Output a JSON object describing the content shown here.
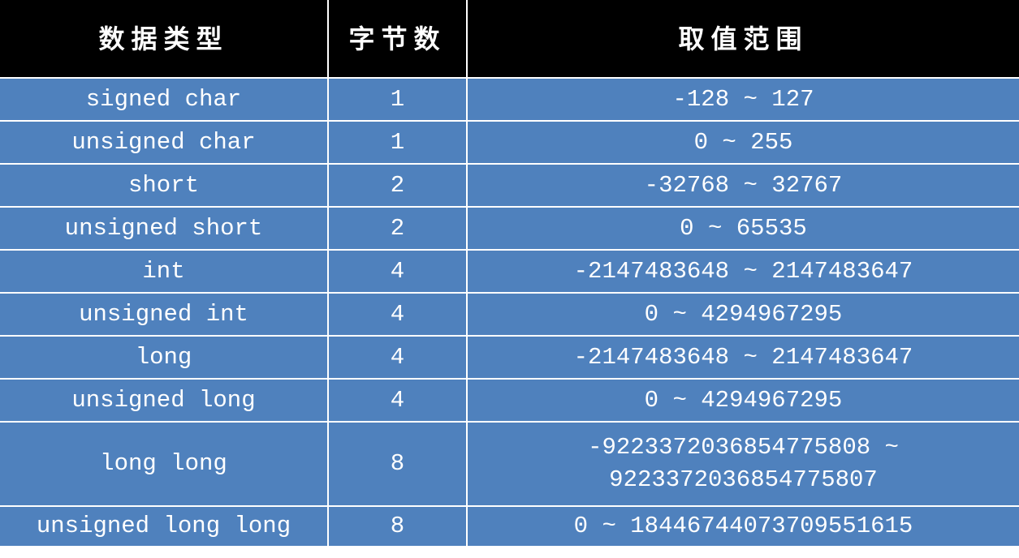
{
  "table": {
    "headers": [
      "数据类型",
      "字节数",
      "取值范围"
    ],
    "rows": [
      [
        "signed char",
        "1",
        "-128 ~ 127"
      ],
      [
        "unsigned char",
        "1",
        "0 ~ 255"
      ],
      [
        "short",
        "2",
        "-32768 ~ 32767"
      ],
      [
        "unsigned short",
        "2",
        "0 ~ 65535"
      ],
      [
        "int",
        "4",
        "-2147483648 ~ 2147483647"
      ],
      [
        "unsigned int",
        "4",
        "0 ~ 4294967295"
      ],
      [
        "long",
        "4",
        "-2147483648 ~ 2147483647"
      ],
      [
        "unsigned long",
        "4",
        "0 ~ 4294967295"
      ],
      [
        "long long",
        "8",
        "-9223372036854775808 ~ 9223372036854775807"
      ],
      [
        "unsigned long long",
        "8",
        "0 ~ 18446744073709551615"
      ]
    ]
  },
  "colors": {
    "header_bg": "#000000",
    "row_bg": "#4f81bd",
    "text": "#ffffff"
  }
}
